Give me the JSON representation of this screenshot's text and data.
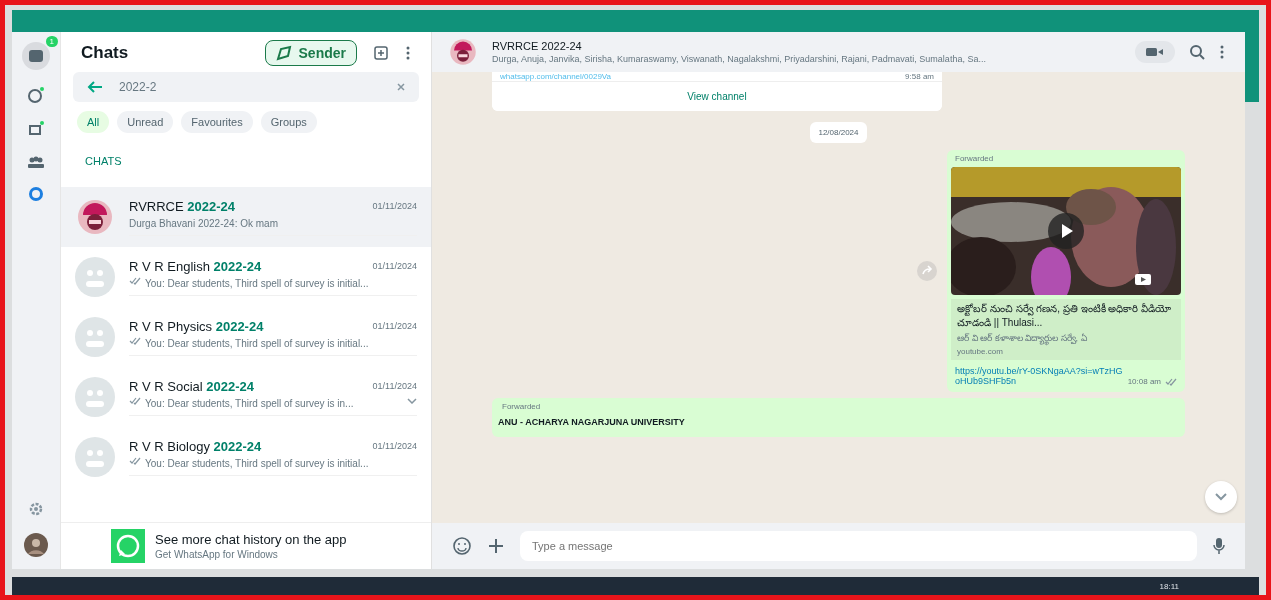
{
  "rail": {
    "badge": "1"
  },
  "sidebar": {
    "title": "Chats",
    "sender_button": "Sender",
    "search": {
      "value": "2022-2"
    },
    "filters": [
      {
        "label": "All",
        "selected": true
      },
      {
        "label": "Unread",
        "selected": false
      },
      {
        "label": "Favourites",
        "selected": false
      },
      {
        "label": "Groups",
        "selected": false
      }
    ],
    "section_label": "CHATS",
    "chats": [
      {
        "name": "RVRRCE ",
        "match": "2022-24",
        "date": "01/11/2024",
        "preview": "Durga Bhavani 2022-24: Ok mam",
        "kind": "group-logo",
        "selected": true,
        "sent": false,
        "menu": false
      },
      {
        "name": "R V R English ",
        "match": "2022-24",
        "date": "01/11/2024",
        "preview": "You: Dear students, Third spell of survey is initial...",
        "kind": "default",
        "selected": false,
        "sent": true,
        "menu": false
      },
      {
        "name": "R V R Physics ",
        "match": "2022-24",
        "date": "01/11/2024",
        "preview": "You: Dear students, Third spell of survey is initial...",
        "kind": "default",
        "selected": false,
        "sent": true,
        "menu": false
      },
      {
        "name": "R V R Social ",
        "match": "2022-24",
        "date": "01/11/2024",
        "preview": "You: Dear students, Third spell of survey is in...",
        "kind": "default",
        "selected": false,
        "sent": true,
        "menu": true
      },
      {
        "name": "R V R Biology ",
        "match": "2022-24",
        "date": "01/11/2024",
        "preview": "You: Dear students, Third spell of survey is initial...",
        "kind": "default",
        "selected": false,
        "sent": true,
        "menu": false
      }
    ],
    "promo": {
      "title": "See more chat history on the app",
      "subtitle": "Get WhatsApp for Windows"
    }
  },
  "conversation": {
    "title": "RVRRCE 2022-24",
    "members": "Durga, Anuja, Janvika, Sirisha, Kumaraswamy, Viswanath, Nagalakshmi, Priyadarshini, Rajani, Padmavati, Sumalatha, Sa...",
    "messages": [
      {
        "kind": "channel",
        "link": "whatsapp.com/channel/0029Va",
        "time": "9:58 am",
        "button": "View channel"
      },
      {
        "kind": "date",
        "text": "12/08/2024"
      },
      {
        "kind": "video",
        "label": "Forwarded",
        "title": "అక్టోబర్ నుంచి సర్వే గణన, ప్రతి ఇంటికీ అధికారి వీడియో చూడండి || Thulasi...",
        "description": "ఆర్ వి ఆర్ కళాశాల విద్యార్థుల సర్వే, ఏ",
        "source": "youtube.com",
        "link": "https://youtu.be/rY-0SKNgaAA?si=wTzHGoHUb9SHFb5n",
        "time": "10:08 am"
      },
      {
        "kind": "text",
        "label": "Forwarded",
        "text": "ANU - ACHARYA NAGARJUNA UNIVERSITY"
      }
    ],
    "composer": {
      "placeholder": "Type a message"
    }
  },
  "taskbar": {
    "time": "18:11"
  }
}
